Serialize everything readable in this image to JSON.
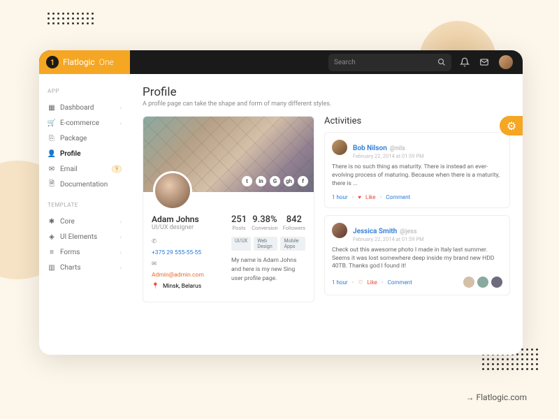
{
  "brand": {
    "name": "Flatlogic",
    "suffix": "One",
    "badge": "1"
  },
  "search": {
    "placeholder": "Search"
  },
  "sidebar": {
    "section1": "APP",
    "section2": "TEMPLATE",
    "items": [
      "Dashboard",
      "E-commerce",
      "Package",
      "Profile",
      "Email",
      "Documentation"
    ],
    "email_badge": "9",
    "template_items": [
      "Core",
      "UI Elements",
      "Forms",
      "Charts"
    ]
  },
  "page": {
    "title": "Profile",
    "subtitle": "A profile page can take the shape and form of many different styles."
  },
  "profile": {
    "name": "Adam Johns",
    "role": "UI/UX designer",
    "phone": "+375 29 555-55-55",
    "email": "Admin@admin.com",
    "location": "Minsk, Belarus",
    "stats": {
      "posts_n": "251",
      "posts_l": "Posts",
      "conv_n": "9.38%",
      "conv_l": "Conversion",
      "foll_n": "842",
      "foll_l": "Followers"
    },
    "tags": [
      "UI/UX",
      "Web Design",
      "Mobile Apps"
    ],
    "bio": "My name is Adam Johns and here is my new Sing user profile page."
  },
  "activities": {
    "title": "Activities",
    "items": [
      {
        "name": "Bob Nilson",
        "handle": "@nils",
        "date": "February 22, 2014 at 01:59 PM",
        "text": "There is no such thing as maturity. There is instead an ever-evolving process of maturing. Because when there is a maturity, there is ...",
        "time": "1 hour",
        "like": "Like",
        "comment": "Comment"
      },
      {
        "name": "Jessica Smith",
        "handle": "@jess",
        "date": "February 22, 2014 at 01:59 PM",
        "text": "Check out this awesome photo I made in Italy last summer. Seems it was lost somewhere deep inside my brand new HDD 40TB. Thanks god I found it!",
        "time": "1 hour",
        "like": "Like",
        "comment": "Comment"
      }
    ]
  },
  "footer": "Flatlogic.com"
}
